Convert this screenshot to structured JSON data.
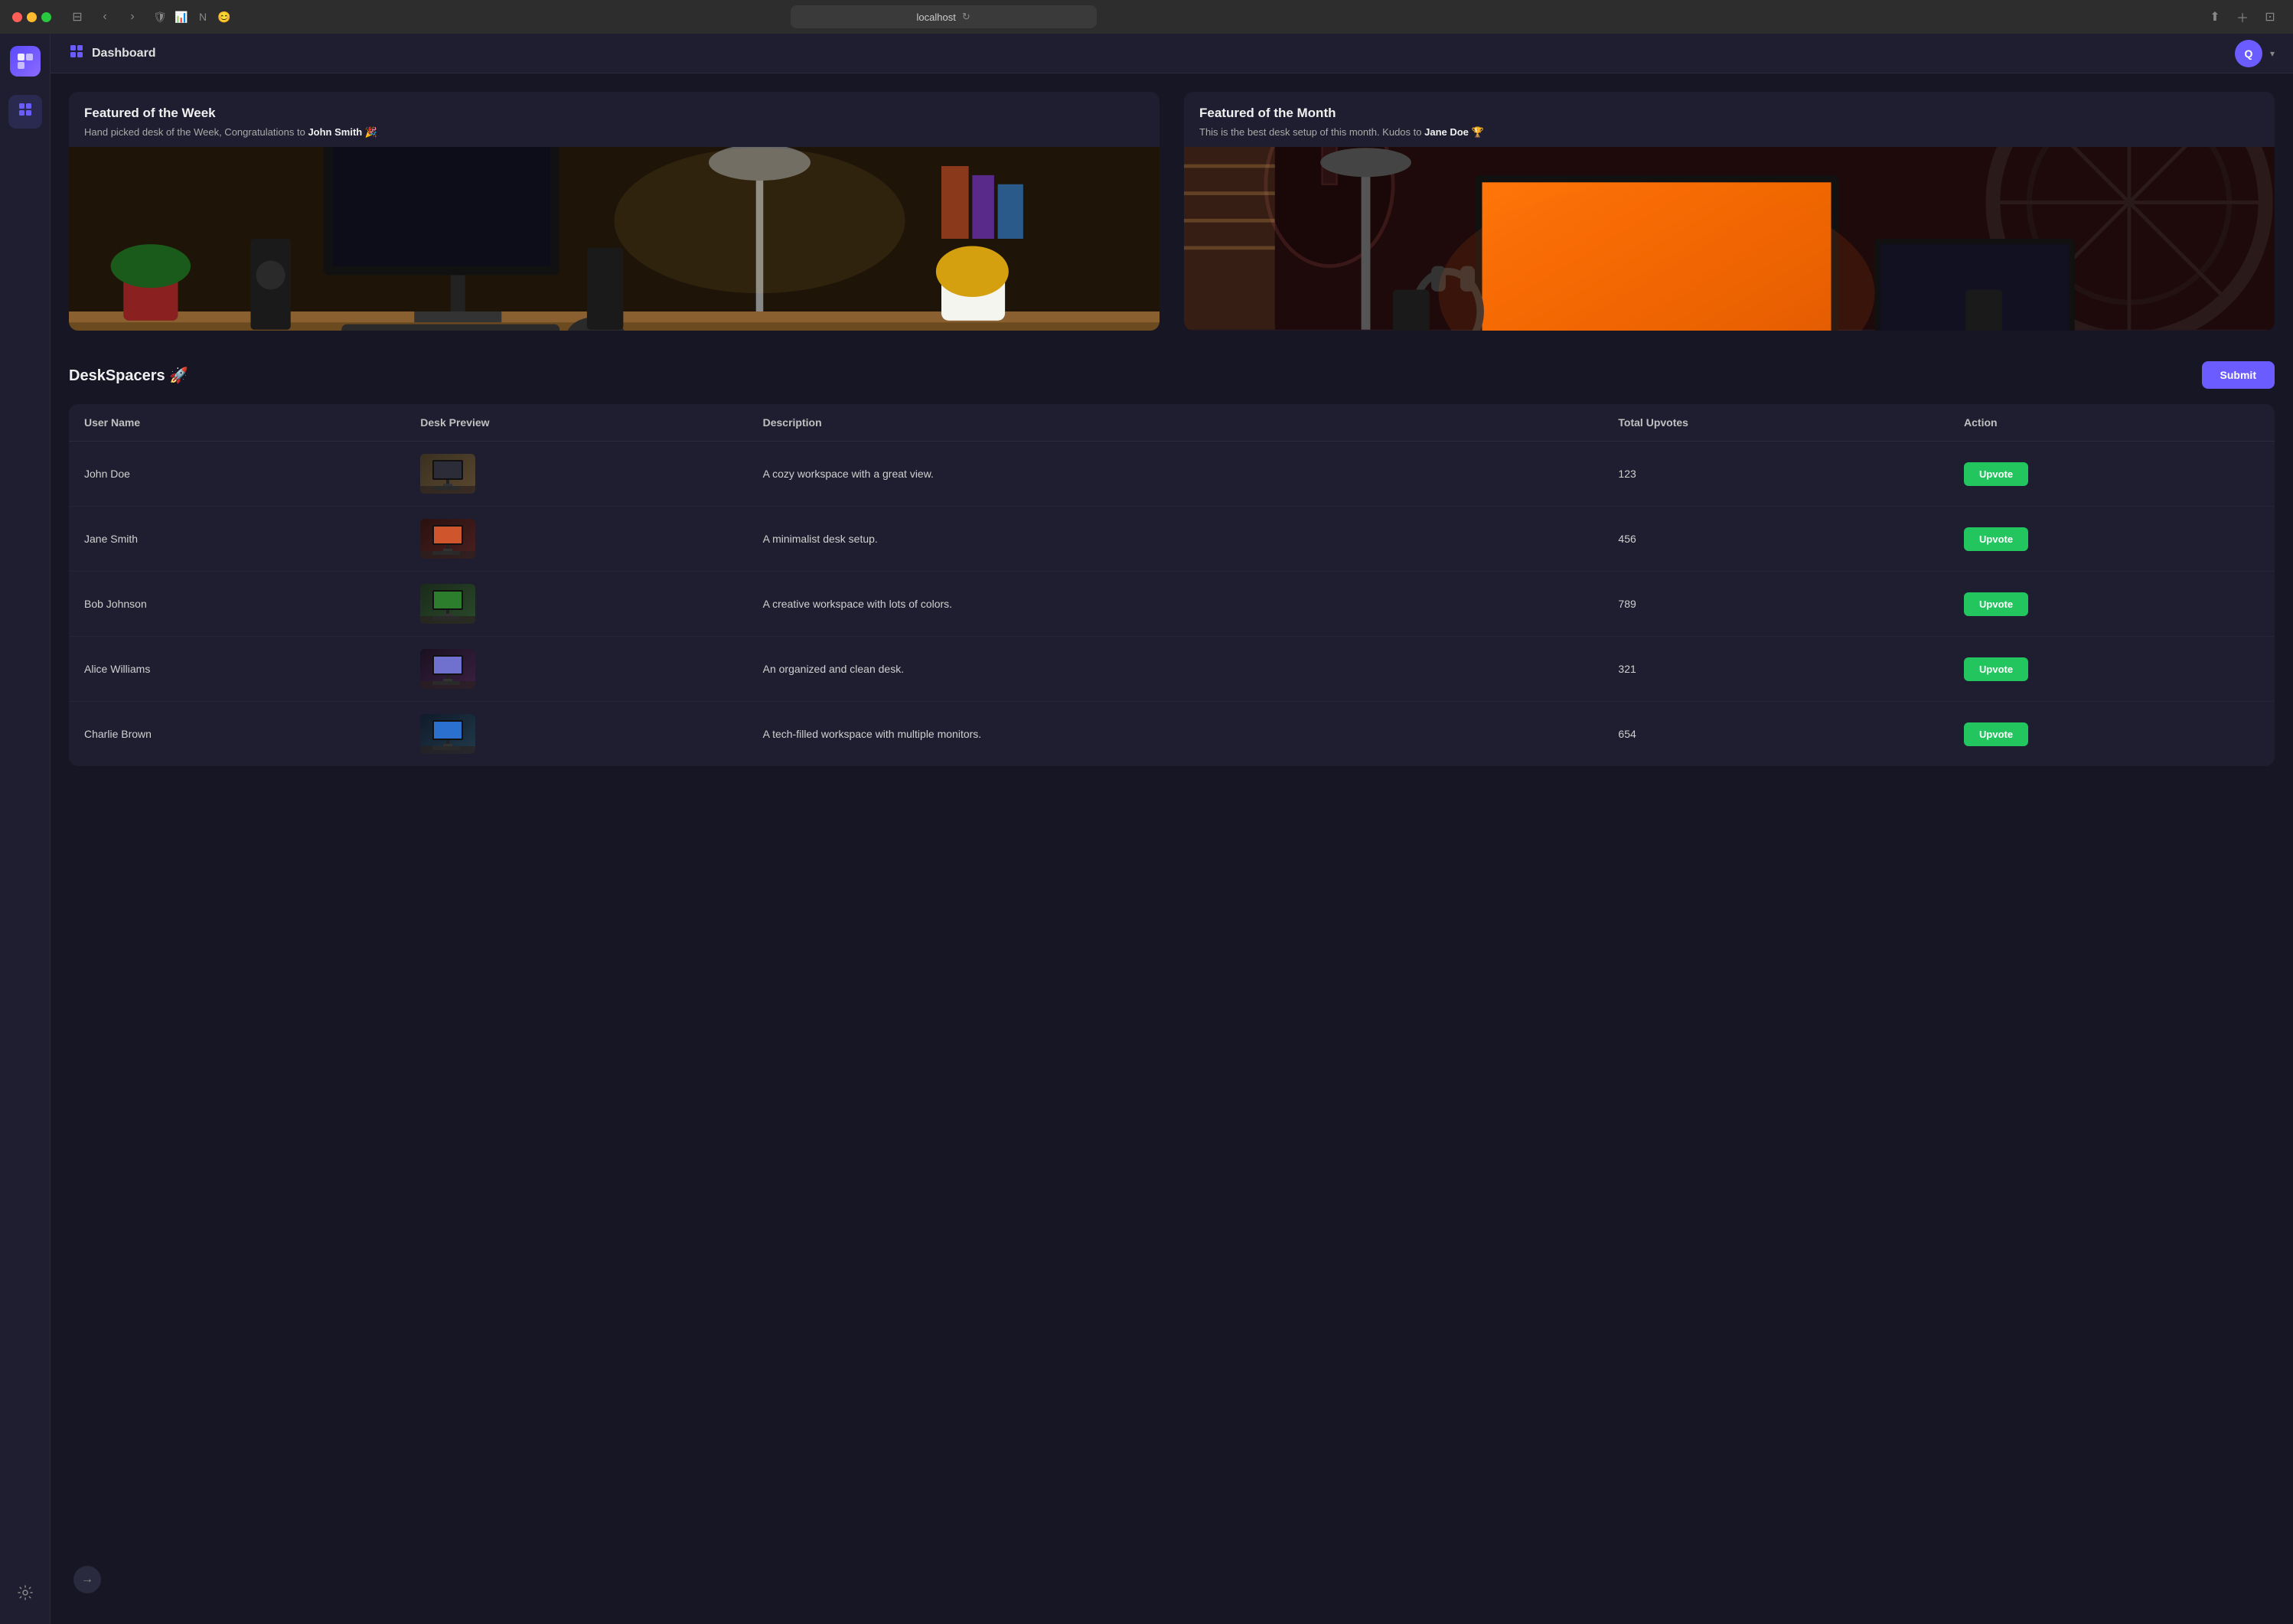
{
  "browser": {
    "url": "localhost",
    "tab_icon": "🌐"
  },
  "topbar": {
    "icon": "⊞",
    "title": "Dashboard",
    "avatar_letter": "Q"
  },
  "sidebar": {
    "items": [
      {
        "id": "grid",
        "icon": "⊞",
        "active": true
      },
      {
        "id": "settings",
        "icon": "⚙"
      }
    ]
  },
  "featured": {
    "week": {
      "title": "Featured of the Week",
      "subtitle_before": "Hand picked desk of the Week, Congratulations to ",
      "highlighted_name": "John Smith",
      "emoji": "🎉"
    },
    "month": {
      "title": "Featured of the Month",
      "subtitle_before": "This is the best desk setup of this month. Kudos to ",
      "highlighted_name": "Jane Doe",
      "emoji": "🏆"
    }
  },
  "table_section": {
    "title": "DeskSpacers 🚀",
    "submit_label": "Submit",
    "columns": {
      "user_name": "User Name",
      "desk_preview": "Desk Preview",
      "description": "Description",
      "total_upvotes": "Total Upvotes",
      "action": "Action"
    },
    "rows": [
      {
        "id": 1,
        "user_name": "John Doe",
        "description": "A cozy workspace with a great view.",
        "total_upvotes": "123",
        "upvote_label": "Upvote",
        "thumb_class": "thumb-week"
      },
      {
        "id": 2,
        "user_name": "Jane Smith",
        "description": "A minimalist desk setup.",
        "total_upvotes": "456",
        "upvote_label": "Upvote",
        "thumb_class": "thumb-month"
      },
      {
        "id": 3,
        "user_name": "Bob Johnson",
        "description": "A creative workspace with lots of colors.",
        "total_upvotes": "789",
        "upvote_label": "Upvote",
        "thumb_class": "thumb-colored"
      },
      {
        "id": 4,
        "user_name": "Alice Williams",
        "description": "An organized and clean desk.",
        "total_upvotes": "321",
        "upvote_label": "Upvote",
        "thumb_class": "thumb-clean"
      },
      {
        "id": 5,
        "user_name": "Charlie Brown",
        "description": "A tech-filled workspace with multiple monitors.",
        "total_upvotes": "654",
        "upvote_label": "Upvote",
        "thumb_class": "thumb-tech"
      }
    ]
  },
  "nav_arrow_icon": "→"
}
